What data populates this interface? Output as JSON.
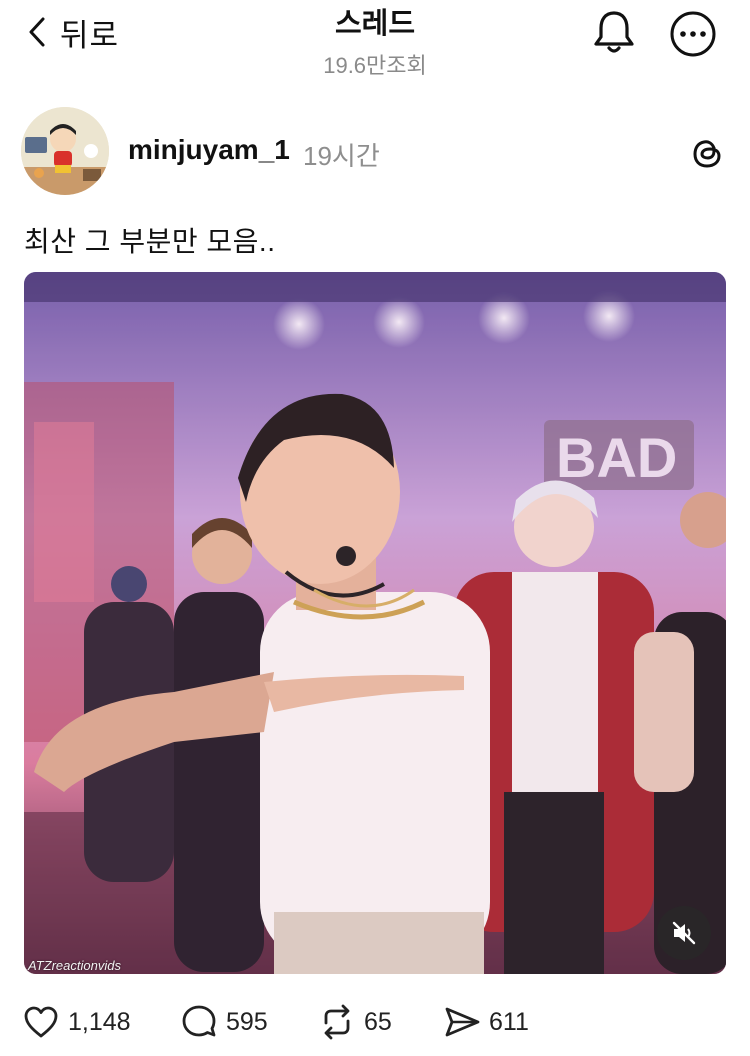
{
  "header": {
    "back_label": "뒤로",
    "title": "스레드",
    "views": "19.6만조회"
  },
  "post": {
    "username": "minjuyam_1",
    "time": "19시간",
    "text": "최산 그 부분만 모음..",
    "media": {
      "watermark": "ATZreactionvids",
      "muted": true
    }
  },
  "actions": {
    "likes": "1,148",
    "replies": "595",
    "reposts": "65",
    "shares": "611"
  },
  "icons": [
    "chevron-left-icon",
    "bell-icon",
    "more-icon",
    "threads-logo-icon",
    "heart-icon",
    "comment-icon",
    "repost-icon",
    "send-icon",
    "mute-icon"
  ]
}
